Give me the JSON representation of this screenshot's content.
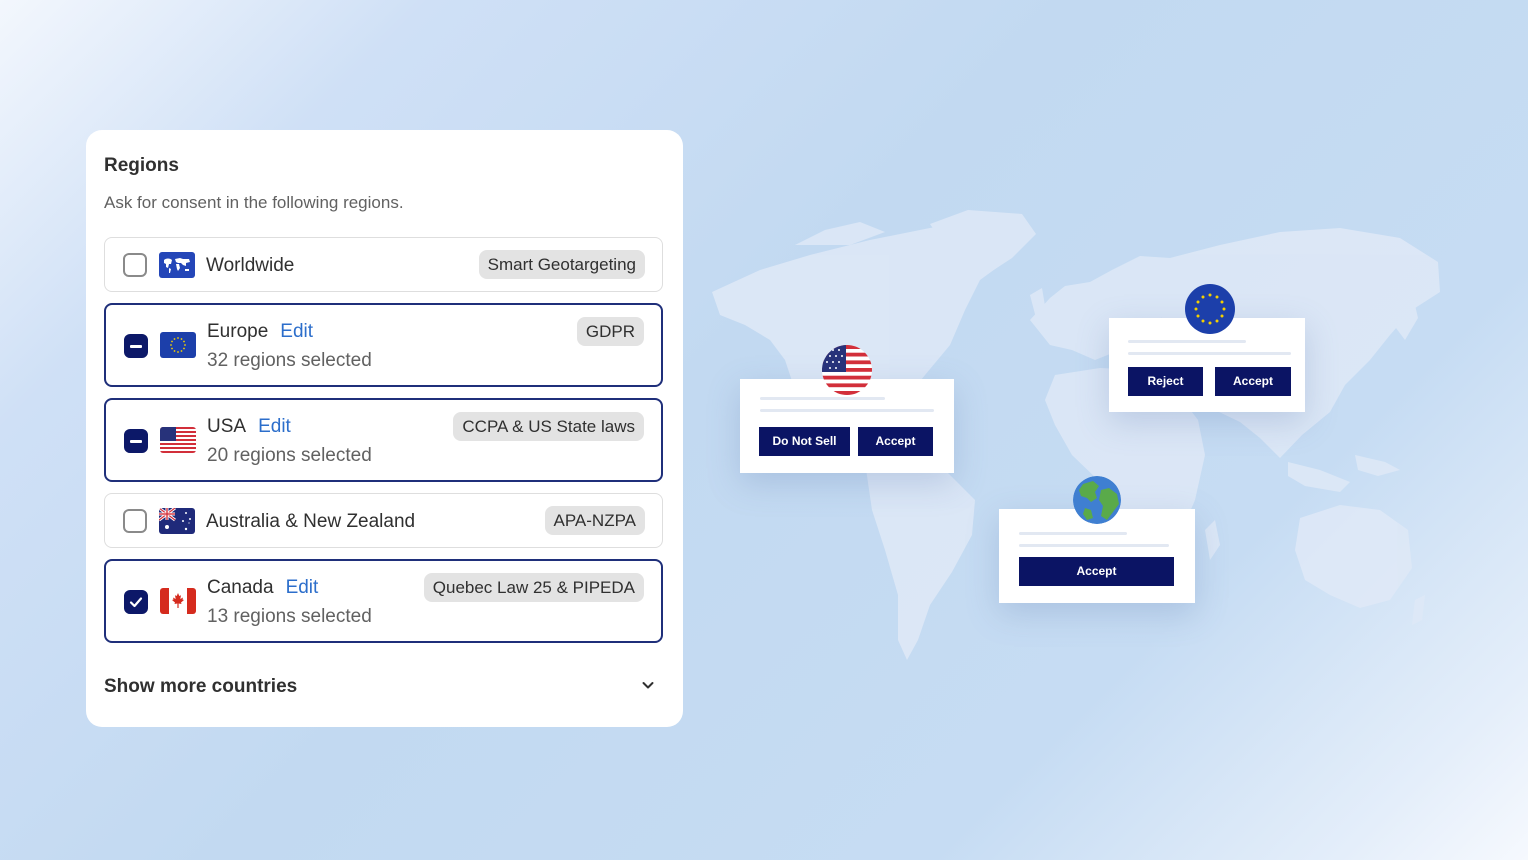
{
  "panel": {
    "title": "Regions",
    "subtitle": "Ask for consent in the following regions.",
    "show_more": "Show more countries"
  },
  "regions": [
    {
      "name": "Worldwide",
      "edit": "",
      "count": "",
      "tag": "Smart Geotargeting",
      "state": "unchecked",
      "flag": "world-map-flag"
    },
    {
      "name": "Europe",
      "edit": "Edit",
      "count": "32 regions selected",
      "tag": "GDPR",
      "state": "indeterminate",
      "flag": "eu-flag"
    },
    {
      "name": "USA",
      "edit": "Edit",
      "count": "20 regions selected",
      "tag": "CCPA & US State laws",
      "state": "indeterminate",
      "flag": "us-flag"
    },
    {
      "name": "Australia & New Zealand",
      "edit": "",
      "count": "",
      "tag": "APA-NZPA",
      "state": "unchecked",
      "flag": "australia-flag"
    },
    {
      "name": "Canada",
      "edit": "Edit",
      "count": "13 regions selected",
      "tag": "Quebec Law 25 & PIPEDA",
      "state": "checked",
      "flag": "canada-flag"
    }
  ],
  "banners": {
    "usa": {
      "buttons": [
        "Do Not Sell",
        "Accept"
      ]
    },
    "europe": {
      "buttons": [
        "Reject",
        "Accept"
      ]
    },
    "world": {
      "buttons": [
        "Accept"
      ]
    }
  },
  "colors": {
    "accent": "#0b1464",
    "link": "#2c6ecb",
    "selected_border": "#1f2f7a"
  }
}
